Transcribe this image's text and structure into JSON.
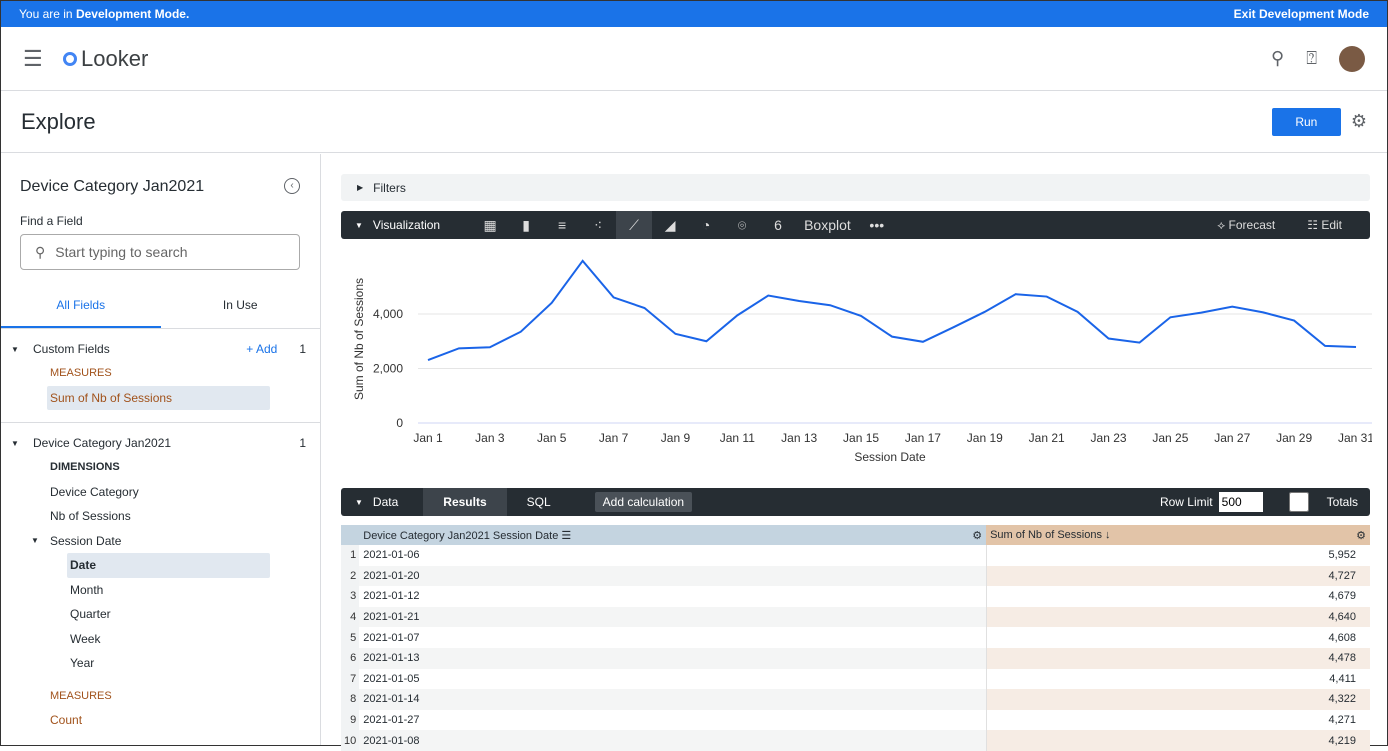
{
  "devbar": {
    "prefix": "You are in ",
    "mode": "Development Mode.",
    "exit": "Exit Development Mode"
  },
  "header": {
    "logo": "Looker"
  },
  "explore": {
    "title": "Explore",
    "run": "Run"
  },
  "sidebar": {
    "title": "Device Category Jan2021",
    "find_label": "Find a Field",
    "search_placeholder": "Start typing to search",
    "tabs": [
      "All Fields",
      "In Use"
    ],
    "custom": {
      "label": "Custom Fields",
      "add": "+ Add",
      "count": "1",
      "measures": "MEASURES",
      "fields": [
        "Sum of Nb of Sessions"
      ]
    },
    "view": {
      "label": "Device Category Jan2021",
      "count": "1",
      "dimensions": "DIMENSIONS",
      "dims": [
        "Device Category",
        "Nb of Sessions"
      ],
      "session_date": "Session Date",
      "timeframes": [
        "Date",
        "Month",
        "Quarter",
        "Week",
        "Year"
      ],
      "measures": "MEASURES",
      "meas": [
        "Count"
      ]
    }
  },
  "filters": {
    "label": "Filters"
  },
  "visualization": {
    "label": "Visualization",
    "boxplot": "Boxplot",
    "forecast": "Forecast",
    "edit": "Edit",
    "single_value": "6",
    "active": "line"
  },
  "chart_data": {
    "type": "line",
    "xlabel": "Session Date",
    "ylabel": "Sum of Nb of Sessions",
    "ylim": [
      0,
      6000
    ],
    "yticks": [
      "0",
      "2,000",
      "4,000"
    ],
    "grid": true,
    "xticks": [
      "Jan 1",
      "Jan 3",
      "Jan 5",
      "Jan 7",
      "Jan 9",
      "Jan 11",
      "Jan 13",
      "Jan 15",
      "Jan 17",
      "Jan 19",
      "Jan 21",
      "Jan 23",
      "Jan 25",
      "Jan 27",
      "Jan 29",
      "Jan 31"
    ],
    "x": [
      "2021-01-01",
      "2021-01-02",
      "2021-01-03",
      "2021-01-04",
      "2021-01-05",
      "2021-01-06",
      "2021-01-07",
      "2021-01-08",
      "2021-01-09",
      "2021-01-10",
      "2021-01-11",
      "2021-01-12",
      "2021-01-13",
      "2021-01-14",
      "2021-01-15",
      "2021-01-16",
      "2021-01-17",
      "2021-01-18",
      "2021-01-19",
      "2021-01-20",
      "2021-01-21",
      "2021-01-22",
      "2021-01-23",
      "2021-01-24",
      "2021-01-25",
      "2021-01-26",
      "2021-01-27",
      "2021-01-28",
      "2021-01-29",
      "2021-01-30",
      "2021-01-31"
    ],
    "values": [
      2310,
      2740,
      2780,
      3350,
      4411,
      5952,
      4608,
      4219,
      3270,
      3000,
      3950,
      4679,
      4478,
      4322,
      3930,
      3170,
      2980,
      3520,
      4080,
      4727,
      4640,
      4080,
      3100,
      2950,
      3880,
      4050,
      4271,
      4060,
      3760,
      2830,
      2790
    ],
    "color": "#1a64e8"
  },
  "data": {
    "label": "Data",
    "tabs": [
      "Results",
      "SQL"
    ],
    "add_calc": "Add calculation",
    "row_limit_label": "Row Limit",
    "row_limit": "500",
    "totals": "Totals",
    "columns": [
      "Device Category Jan2021 Session Date",
      "Sum of Nb of Sessions ↓"
    ],
    "rows": [
      [
        "1",
        "2021-01-06",
        "5,952"
      ],
      [
        "2",
        "2021-01-20",
        "4,727"
      ],
      [
        "3",
        "2021-01-12",
        "4,679"
      ],
      [
        "4",
        "2021-01-21",
        "4,640"
      ],
      [
        "5",
        "2021-01-07",
        "4,608"
      ],
      [
        "6",
        "2021-01-13",
        "4,478"
      ],
      [
        "7",
        "2021-01-05",
        "4,411"
      ],
      [
        "8",
        "2021-01-14",
        "4,322"
      ],
      [
        "9",
        "2021-01-27",
        "4,271"
      ],
      [
        "10",
        "2021-01-08",
        "4,219"
      ]
    ]
  }
}
